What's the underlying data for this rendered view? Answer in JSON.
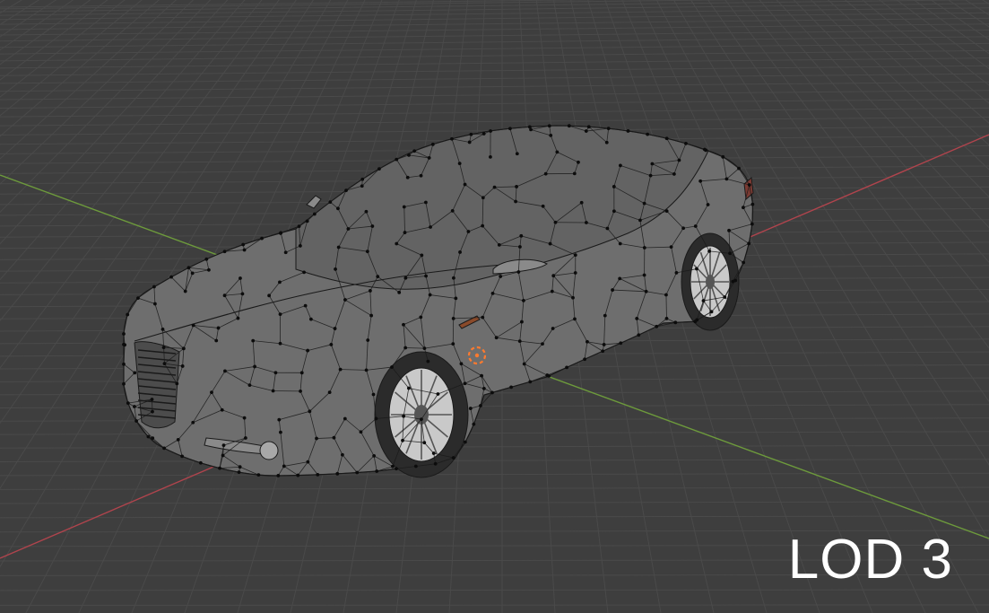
{
  "viewport": {
    "overlay_label": "LOD 3",
    "colors": {
      "background": "#3e3e3e",
      "grid_line": "#4a4a4a",
      "x_axis": "#b0444d",
      "y_axis": "#6d9a3c",
      "mesh_fill": "#6e6e6e",
      "mesh_shadow": "#4c4c4c",
      "mesh_edge": "#1a1a1a",
      "vertex": "#0c0c0c",
      "wheel_rim": "#c9c9c9",
      "tire": "#2b2b2b",
      "origin_cursor": "#ff7a2e",
      "label_text": "#ffffff"
    },
    "icons": [
      "3d-cursor-icon"
    ],
    "objects": [
      {
        "name": "car-mesh",
        "mode": "edit-mode",
        "display": "wireframe-with-vertices"
      }
    ]
  }
}
